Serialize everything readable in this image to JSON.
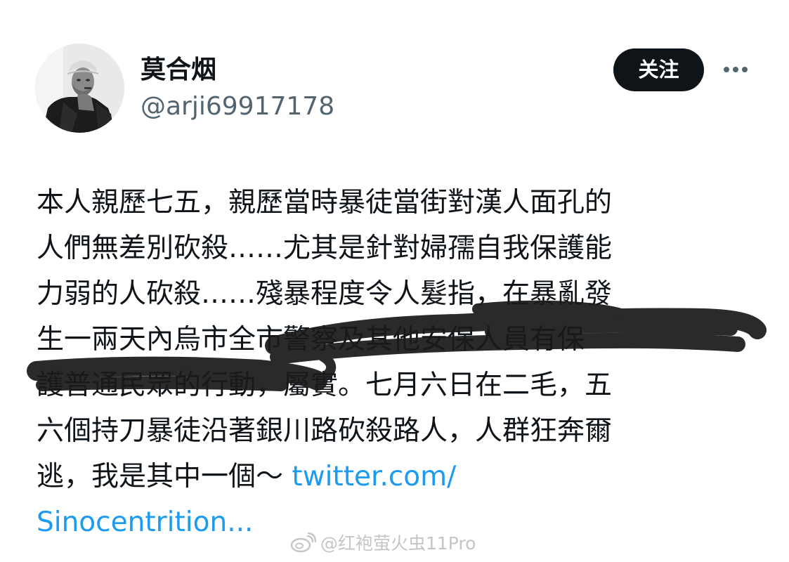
{
  "profile": {
    "display_name": "莫合烟",
    "handle": "@arji69917178",
    "avatar_icon": "elderly-man-photo-avatar"
  },
  "actions": {
    "follow_label": "关注",
    "more_icon": "more-horizontal-icon"
  },
  "tweet": {
    "lines": [
      "本人親歷七五，親歷當時暴徒當街對漢人面孔的",
      "人們無差別砍殺……尤其是針對婦孺自我保護能",
      "力弱的人砍殺……殘暴程度令人髮指，在暴亂發",
      "生一兩天內烏市全市警察及其他安保人員有保",
      "護普通民眾的行動，屬實。七月六日在二毛，五",
      "六個持刀暴徒沿著銀川路砍殺路人，人群狂奔爾",
      "逃，我是其中一個～ "
    ],
    "link_part1": "twitter.com/",
    "link_part2": "Sinocentrition..."
  },
  "watermark": {
    "text": "@红袍萤火虫11Pro",
    "icon": "weibo-logo-icon"
  },
  "colors": {
    "text": "#0f1419",
    "secondary": "#536471",
    "link": "#1d9bf0",
    "button_bg": "#0f1419",
    "scribble": "#1a1a1a"
  }
}
